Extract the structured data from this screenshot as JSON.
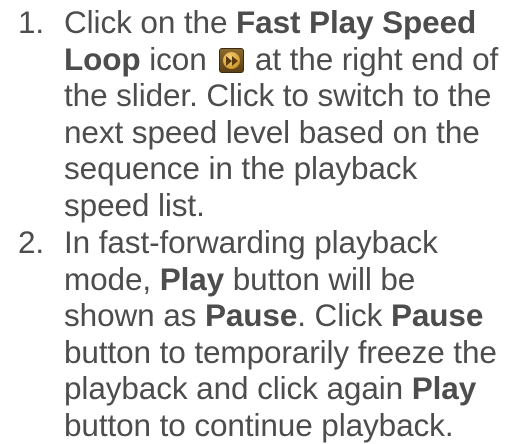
{
  "steps": [
    {
      "number": "1.",
      "parts": {
        "p1": "Click on the ",
        "b1": "Fast Play Speed Loop",
        "p2": " icon ",
        "p3": " at the right end of the slider. Click to switch to the next speed level based on the sequence in the playback speed list."
      },
      "icon": "fast-forward-icon"
    },
    {
      "number": "2.",
      "parts": {
        "p1": "In fast-forwarding playback mode, ",
        "b1": "Play",
        "p2": " button will be shown as ",
        "b2": "Pause",
        "p3": ". Click ",
        "b3": "Pause",
        "p4": " button to temporarily freeze the playback and click again ",
        "b4": "Play",
        "p5": " button to continue playback."
      }
    }
  ],
  "colors": {
    "text": "#4d4d4d",
    "icon_bg": "#6e5220",
    "icon_fg": "#d7a336"
  }
}
